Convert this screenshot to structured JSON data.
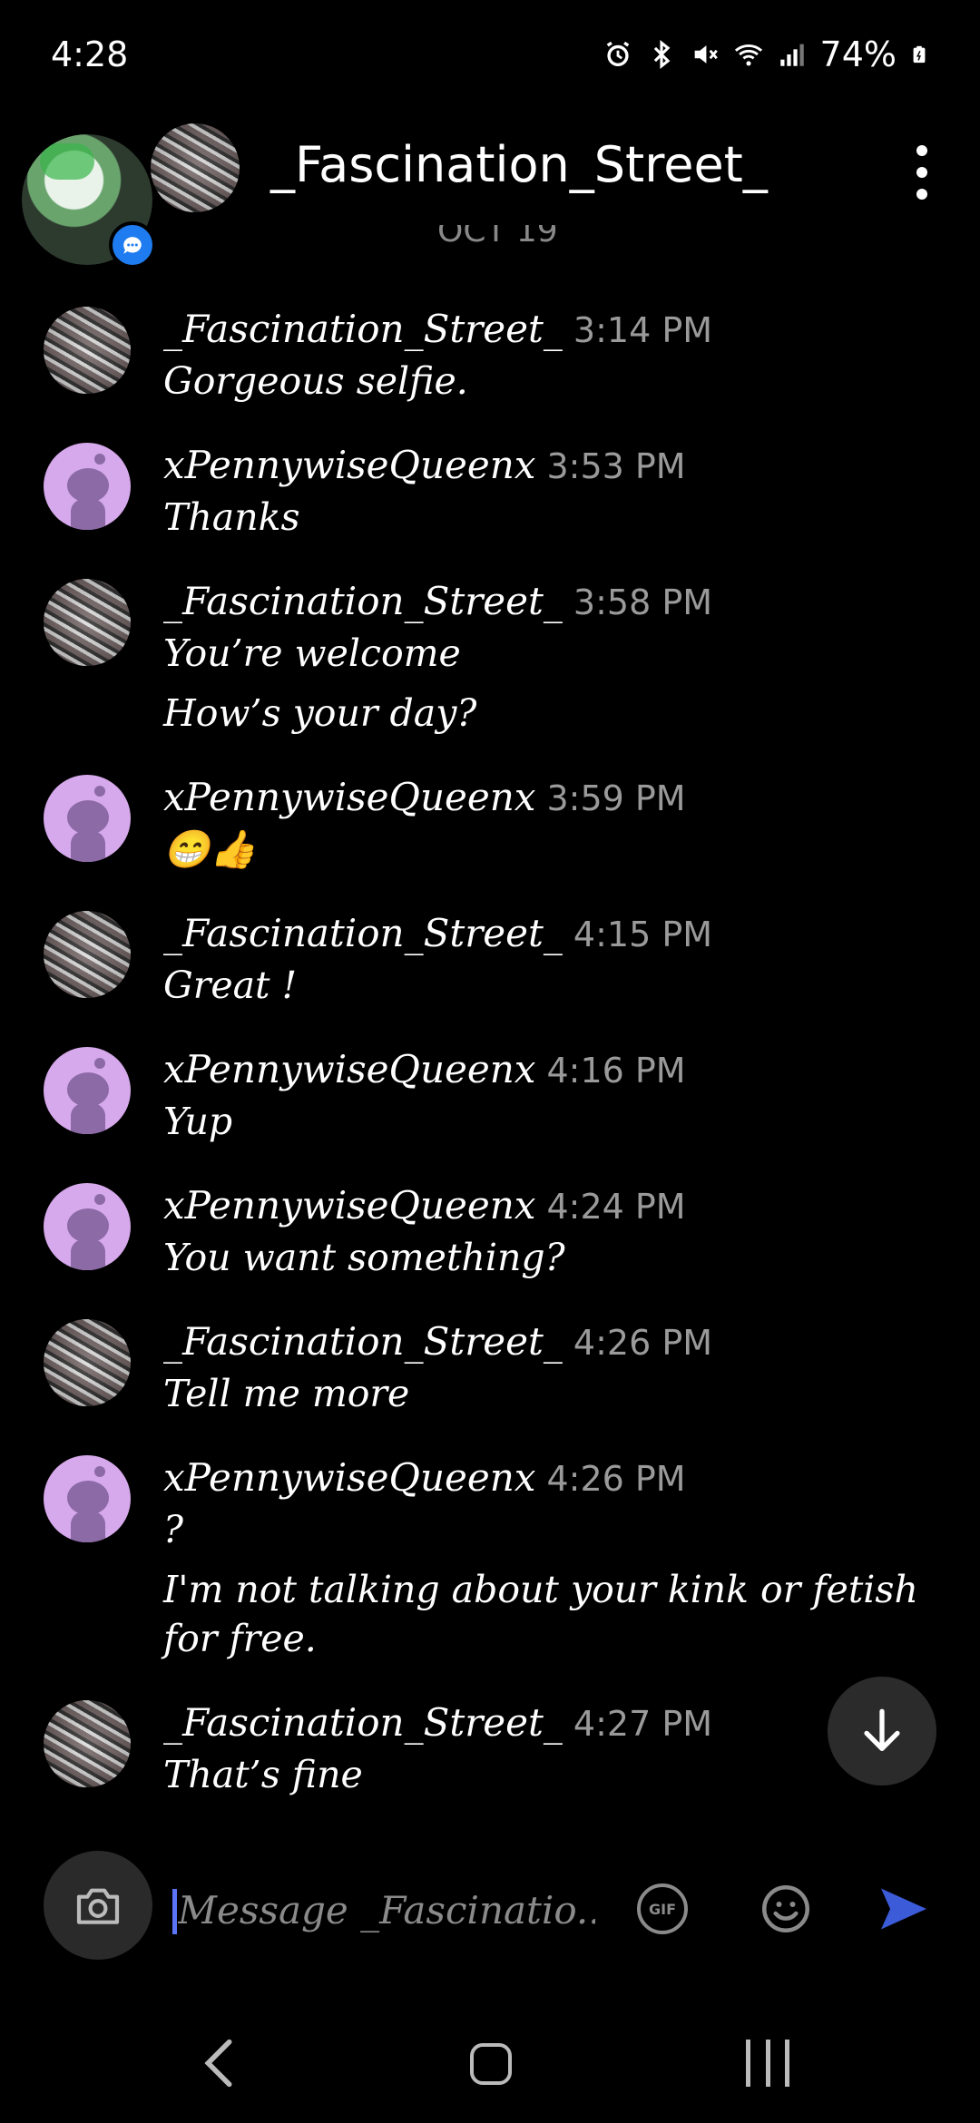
{
  "status_bar": {
    "time": "4:28",
    "battery": "74%",
    "icons": [
      "alarm-icon",
      "bluetooth-icon",
      "mute-icon",
      "wifi-icon",
      "signal-icon",
      "battery-icon"
    ]
  },
  "header": {
    "title": "_Fascination_Street_",
    "date_divider": "OCT 19"
  },
  "messages": [
    {
      "user": "_Fascination_Street_",
      "time": "3:14 PM",
      "avatar": "fs",
      "lines": [
        "Gorgeous selfie."
      ]
    },
    {
      "user": "xPennywiseQueenx",
      "time": "3:53 PM",
      "avatar": "pw",
      "lines": [
        "Thanks"
      ]
    },
    {
      "user": "_Fascination_Street_",
      "time": "3:58 PM",
      "avatar": "fs",
      "lines": [
        "You’re welcome",
        "How’s your day?"
      ]
    },
    {
      "user": "xPennywiseQueenx",
      "time": "3:59 PM",
      "avatar": "pw",
      "lines": [
        "😁👍"
      ]
    },
    {
      "user": "_Fascination_Street_",
      "time": "4:15 PM",
      "avatar": "fs",
      "lines": [
        "Great !"
      ]
    },
    {
      "user": "xPennywiseQueenx",
      "time": "4:16 PM",
      "avatar": "pw",
      "lines": [
        "Yup"
      ]
    },
    {
      "user": "xPennywiseQueenx",
      "time": "4:24 PM",
      "avatar": "pw",
      "lines": [
        "You want something?"
      ]
    },
    {
      "user": "_Fascination_Street_",
      "time": "4:26 PM",
      "avatar": "fs",
      "lines": [
        "Tell me more"
      ]
    },
    {
      "user": "xPennywiseQueenx",
      "time": "4:26 PM",
      "avatar": "pw",
      "lines": [
        "?",
        "I'm not talking about your kink or fetish",
        "for free."
      ]
    },
    {
      "user": "_Fascination_Street_",
      "time": "4:27 PM",
      "avatar": "fs",
      "lines": [
        "That’s fine"
      ]
    }
  ],
  "composer": {
    "placeholder": "Message _Fascinatio...",
    "gif_label": "GIF"
  },
  "colors": {
    "background": "#000000",
    "accent": "#1f7cf0",
    "pennywise_avatar": "#d6a8ec"
  }
}
